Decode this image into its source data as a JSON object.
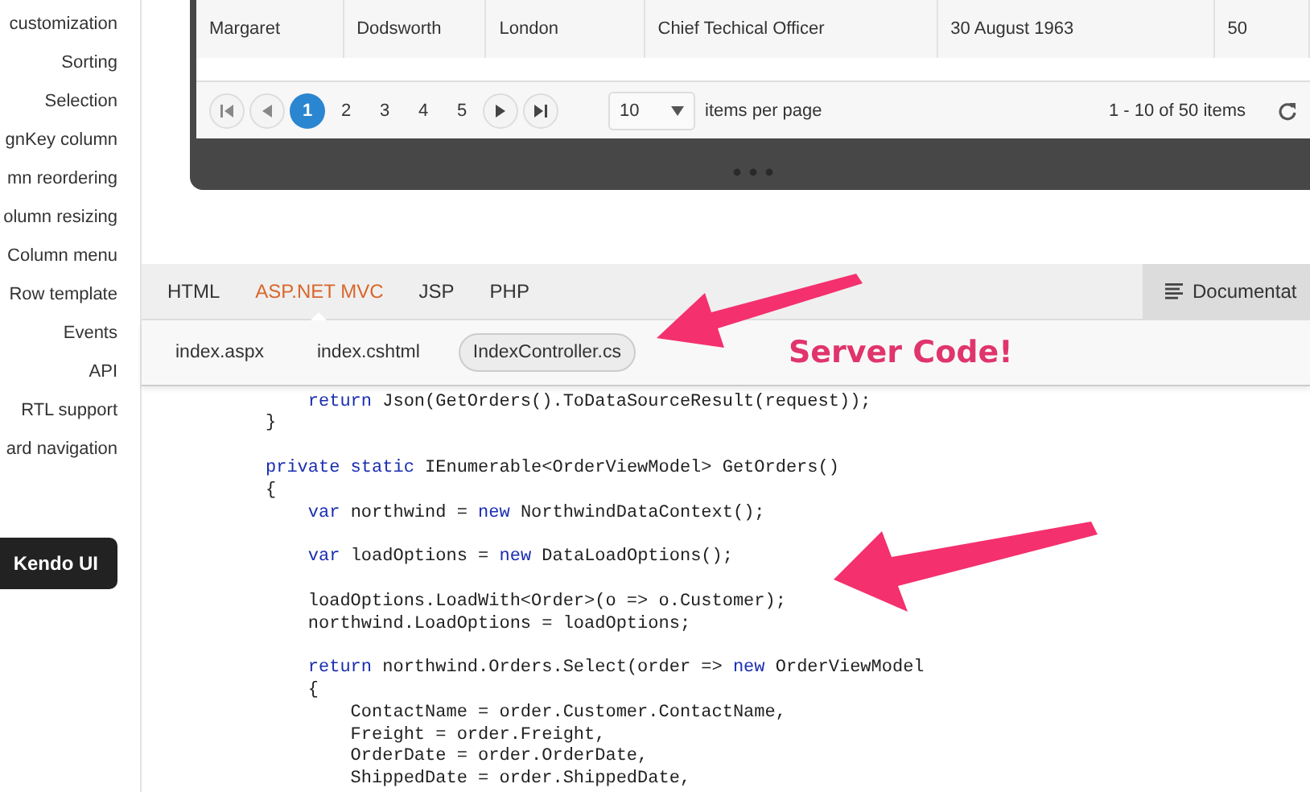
{
  "sidebar": {
    "items": [
      {
        "label": "customization"
      },
      {
        "label": "Sorting"
      },
      {
        "label": "Selection"
      },
      {
        "label": "gnKey column"
      },
      {
        "label": "mn reordering"
      },
      {
        "label": "olumn resizing"
      },
      {
        "label": "Column menu"
      },
      {
        "label": "Row template"
      },
      {
        "label": "Events"
      },
      {
        "label": "API"
      },
      {
        "label": "RTL support"
      },
      {
        "label": "ard navigation"
      }
    ],
    "button": "Kendo UI"
  },
  "grid": {
    "rows": [
      {
        "cells": [
          "Margaret",
          "Dodsworth",
          "London",
          "Chief Techical Officer",
          "30 August 1963",
          "50"
        ]
      }
    ],
    "pager": {
      "pages": [
        {
          "label": "1",
          "selected": true
        },
        {
          "label": "2",
          "selected": false
        },
        {
          "label": "3",
          "selected": false
        },
        {
          "label": "4",
          "selected": false
        },
        {
          "label": "5",
          "selected": false
        }
      ],
      "page_size": "10",
      "page_size_label": "items per page",
      "summary": "1 - 10 of 50 items"
    }
  },
  "source": {
    "tabs": [
      {
        "label": "HTML",
        "selected": false
      },
      {
        "label": "ASP.NET MVC",
        "selected": true
      },
      {
        "label": "JSP",
        "selected": false
      },
      {
        "label": "PHP",
        "selected": false
      }
    ],
    "documentation_button": "Documentat",
    "file_tabs": [
      {
        "label": "index.aspx",
        "selected": false
      },
      {
        "label": "index.cshtml",
        "selected": false
      },
      {
        "label": "IndexController.cs",
        "selected": true
      }
    ],
    "annotation": "Server Code!",
    "code": [
      {
        "blank_before": false,
        "segments": [
          {
            "kind": "keyword",
            "text": "    return"
          },
          {
            "kind": "plain",
            "text": " Json(GetOrders().ToDataSourceResult(request));"
          }
        ]
      },
      {
        "blank_before": false,
        "segments": [
          {
            "kind": "plain",
            "text": "}"
          }
        ]
      },
      {
        "blank_before": true,
        "segments": [
          {
            "kind": "keyword",
            "text": "private static"
          },
          {
            "kind": "plain",
            "text": " IEnumerable<OrderViewModel> GetOrders()"
          }
        ]
      },
      {
        "blank_before": false,
        "segments": [
          {
            "kind": "plain",
            "text": "{"
          }
        ]
      },
      {
        "blank_before": false,
        "segments": [
          {
            "kind": "keyword",
            "text": "    var"
          },
          {
            "kind": "plain",
            "text": " northwind = "
          },
          {
            "kind": "keyword",
            "text": "new"
          },
          {
            "kind": "plain",
            "text": " NorthwindDataContext();"
          }
        ]
      },
      {
        "blank_before": true,
        "segments": [
          {
            "kind": "keyword",
            "text": "    var"
          },
          {
            "kind": "plain",
            "text": " loadOptions = "
          },
          {
            "kind": "keyword",
            "text": "new"
          },
          {
            "kind": "plain",
            "text": " DataLoadOptions();"
          }
        ]
      },
      {
        "blank_before": true,
        "segments": [
          {
            "kind": "plain",
            "text": "    loadOptions.LoadWith<Order>(o => o.Customer);"
          }
        ]
      },
      {
        "blank_before": false,
        "segments": [
          {
            "kind": "plain",
            "text": "    northwind.LoadOptions = loadOptions;"
          }
        ]
      },
      {
        "blank_before": true,
        "segments": [
          {
            "kind": "keyword",
            "text": "    return"
          },
          {
            "kind": "plain",
            "text": " northwind.Orders.Select(order => "
          },
          {
            "kind": "keyword",
            "text": "new"
          },
          {
            "kind": "plain",
            "text": " OrderViewModel"
          }
        ]
      },
      {
        "blank_before": false,
        "segments": [
          {
            "kind": "plain",
            "text": "    {"
          }
        ]
      },
      {
        "blank_before": false,
        "segments": [
          {
            "kind": "plain",
            "text": "        ContactName = order.Customer.ContactName,"
          }
        ]
      },
      {
        "blank_before": false,
        "segments": [
          {
            "kind": "plain",
            "text": "        Freight = order.Freight,"
          }
        ]
      },
      {
        "blank_before": false,
        "segments": [
          {
            "kind": "plain",
            "text": "        OrderDate = order.OrderDate,"
          }
        ]
      },
      {
        "blank_before": false,
        "segments": [
          {
            "kind": "plain",
            "text": "        ShippedDate = order.ShippedDate,"
          }
        ]
      }
    ]
  }
}
